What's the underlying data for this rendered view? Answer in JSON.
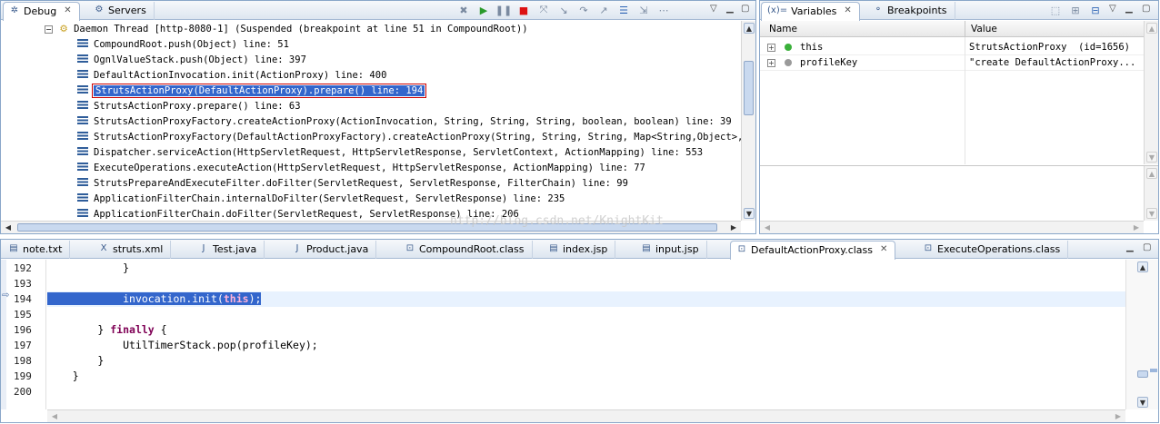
{
  "debug_view": {
    "tabs": [
      {
        "label": "Debug"
      },
      {
        "label": "Servers"
      }
    ],
    "thread_label": "Daemon Thread [http-8080-1] (Suspended (breakpoint at line 51 in CompoundRoot))",
    "frames": [
      "CompoundRoot.push(Object) line: 51",
      "OgnlValueStack.push(Object) line: 397",
      "DefaultActionInvocation.init(ActionProxy) line: 400",
      "StrutsActionProxy(DefaultActionProxy).prepare() line: 194",
      "StrutsActionProxy.prepare() line: 63",
      "StrutsActionProxyFactory.createActionProxy(ActionInvocation, String, String, String, boolean, boolean) line: 39",
      "StrutsActionProxyFactory(DefaultActionProxyFactory).createActionProxy(String, String, String, Map<String,Object>, bool",
      "Dispatcher.serviceAction(HttpServletRequest, HttpServletResponse, ServletContext, ActionMapping) line: 553",
      "ExecuteOperations.executeAction(HttpServletRequest, HttpServletResponse, ActionMapping) line: 77",
      "StrutsPrepareAndExecuteFilter.doFilter(ServletRequest, ServletResponse, FilterChain) line: 99",
      "ApplicationFilterChain.internalDoFilter(ServletRequest, ServletResponse) line: 235",
      "ApplicationFilterChain.doFilter(ServletRequest, ServletResponse) line: 206"
    ],
    "selected_index": 3
  },
  "variables_view": {
    "tabs": [
      {
        "label": "Variables"
      },
      {
        "label": "Breakpoints"
      }
    ],
    "tab_prefix": "(x)=",
    "columns": {
      "name": "Name",
      "value": "Value"
    },
    "rows": [
      {
        "name": "this",
        "value": "StrutsActionProxy  (id=1656)"
      },
      {
        "name": "profileKey",
        "value": "\"create DefaultActionProxy..."
      }
    ]
  },
  "editor": {
    "tabs": [
      {
        "label": "note.txt"
      },
      {
        "label": "struts.xml"
      },
      {
        "label": "Test.java"
      },
      {
        "label": "Product.java"
      },
      {
        "label": "CompoundRoot.class"
      },
      {
        "label": "index.jsp"
      },
      {
        "label": "input.jsp"
      },
      {
        "label": "DefaultActionProxy.class"
      },
      {
        "label": "ExecuteOperations.class"
      }
    ],
    "active_tab_index": 7,
    "line_numbers": [
      "192",
      "193",
      "194",
      "195",
      "196",
      "197",
      "198",
      "199",
      "200"
    ],
    "code": {
      "l192": "            }",
      "l194_call": "invocation.init(",
      "l194_this": "this",
      "l194_end": ");",
      "l196_pre": "        } ",
      "l196_kw": "finally",
      "l196_post": " {",
      "l197": "            UtilTimerStack.pop(profileKey);",
      "l198": "        }",
      "l199": "    }"
    }
  },
  "watermark": "http://blog.csdn.net/KnightKit",
  "colors": {
    "selection": "#3366cc",
    "keyword": "#7f0055",
    "breakpoint_box": "#cc0000"
  }
}
